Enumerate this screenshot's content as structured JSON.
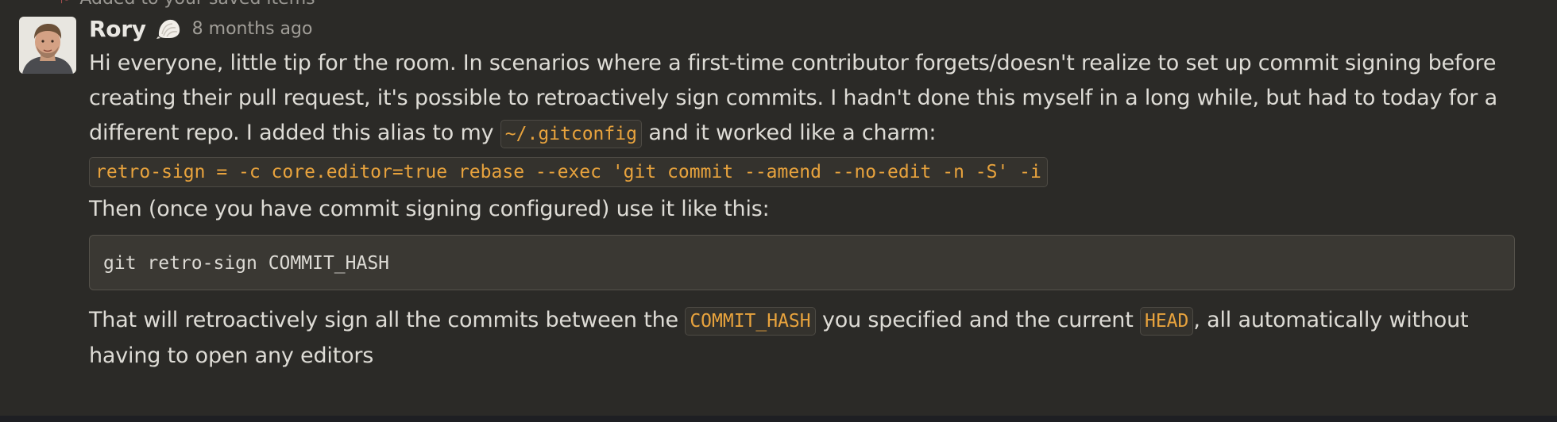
{
  "banner": {
    "text": "Added to your saved items"
  },
  "message": {
    "author": "Rory",
    "status_emoji": "shell-icon",
    "timestamp": "8 months ago",
    "paragraph1": {
      "part1": "Hi everyone, little tip for the room. In scenarios where a first-time contributor forgets/doesn't realize to set up commit signing before creating their pull request, it's possible to retroactively sign commits. I hadn't done this myself in a long while, but had to today for a different repo. I added this alias to my ",
      "code": "~/.gitconfig",
      "part2": " and it worked like a charm:"
    },
    "alias_code": "retro-sign = -c core.editor=true rebase --exec 'git commit --amend --no-edit -n -S' -i",
    "paragraph2": "Then (once you have commit signing configured) use it like this:",
    "code_block": "git retro-sign COMMIT_HASH",
    "paragraph3": {
      "part1": "That will retroactively sign all the commits between the ",
      "code1": "COMMIT_HASH",
      "part2": " you specified and the current ",
      "code2": "HEAD",
      "part3": ", all automatically without having to open any editors"
    }
  },
  "colors": {
    "background": "#2b2a27",
    "code_accent": "#e8a33d",
    "text": "#dedcd6"
  }
}
